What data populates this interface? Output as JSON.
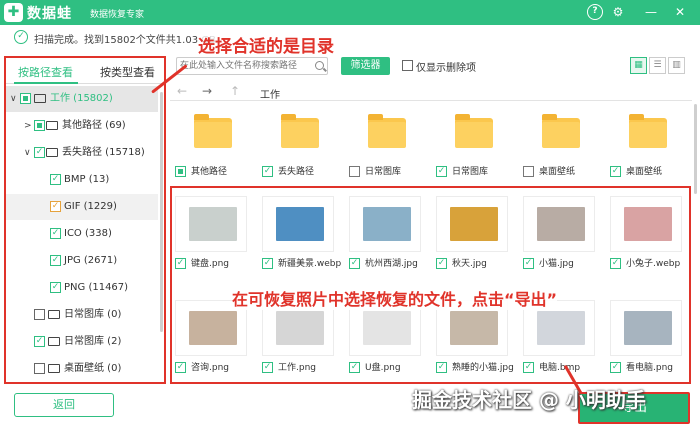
{
  "titlebar": {
    "logo": "✚",
    "app_name": "数据蛙",
    "app_subtitle": "数据恢复专家",
    "help": "?",
    "gear": "⚙",
    "min": "—",
    "close": "✕"
  },
  "status": {
    "icon": "✓",
    "text": "扫描完成。找到15802个文件共1.03 GB。"
  },
  "tabs": {
    "path": "按路径查看",
    "type": "按类型查看"
  },
  "tree": [
    {
      "label": "工作 (15802)",
      "arrow": "∨",
      "check": "partial",
      "icon": true,
      "accent": "#2fbf82"
    },
    {
      "label": "其他路径 (69)",
      "arrow": ">",
      "check": "partial",
      "icon": true
    },
    {
      "label": "丢失路径 (15718)",
      "arrow": "∨",
      "check": "checked",
      "icon": true
    },
    {
      "label": "BMP (13)",
      "check": "checked"
    },
    {
      "label": "GIF (1229)",
      "check": "checked-orange"
    },
    {
      "label": "ICO (338)",
      "check": "checked"
    },
    {
      "label": "JPG (2671)",
      "check": "checked"
    },
    {
      "label": "PNG (11467)",
      "check": "checked"
    },
    {
      "label": "日常图库 (0)",
      "check": "empty",
      "icon": true
    },
    {
      "label": "日常图库 (2)",
      "check": "checked",
      "icon": true
    },
    {
      "label": "桌面壁纸 (0)",
      "check": "empty",
      "icon": true
    }
  ],
  "back_button": "返回",
  "search": {
    "placeholder": "在此处输入文件名称搜索路径"
  },
  "filter_button": "筛选器",
  "deleted_only": "仅显示删除项",
  "view": {
    "grid": "▦",
    "list": "☰",
    "detail": "▥"
  },
  "nav": {
    "back": "←",
    "forward": "→",
    "up": "↑",
    "path": "工作"
  },
  "files": [
    {
      "name": "其他路径",
      "type": "folder",
      "checked": "partial"
    },
    {
      "name": "丢失路径",
      "type": "folder",
      "checked": true
    },
    {
      "name": "日常图库",
      "type": "folder",
      "checked": false
    },
    {
      "name": "日常图库",
      "type": "folder",
      "checked": true
    },
    {
      "name": "桌面壁纸",
      "type": "folder",
      "checked": false
    },
    {
      "name": "桌面壁纸",
      "type": "folder",
      "checked": true
    },
    {
      "name": "键盘.png",
      "type": "photo",
      "checked": true,
      "color": "#c9d0cd"
    },
    {
      "name": "新疆美景.webp",
      "type": "photo",
      "checked": true,
      "color": "#4f8fc2"
    },
    {
      "name": "杭州西湖.jpg",
      "type": "photo",
      "checked": true,
      "color": "#8ab0c8"
    },
    {
      "name": "秋天.jpg",
      "type": "photo",
      "checked": true,
      "color": "#d8a23a"
    },
    {
      "name": "小猫.jpg",
      "type": "photo",
      "checked": true,
      "color": "#b8aca4"
    },
    {
      "name": "小兔子.webp",
      "type": "photo",
      "checked": true,
      "color": "#d9a3a3"
    },
    {
      "name": "咨询.png",
      "type": "photo",
      "checked": true,
      "color": "#c7b29e"
    },
    {
      "name": "工作.png",
      "type": "photo",
      "checked": true,
      "color": "#d6d6d6"
    },
    {
      "name": "U盘.png",
      "type": "photo",
      "checked": true,
      "color": "#e4e4e4"
    },
    {
      "name": "熟睡的小猫.jpg",
      "type": "photo",
      "checked": true,
      "color": "#c6b8a8"
    },
    {
      "name": "电脑.bmp",
      "type": "photo",
      "checked": true,
      "color": "#d2d6dc"
    },
    {
      "name": "看电脑.png",
      "type": "photo",
      "checked": true,
      "color": "#a7b4bf"
    }
  ],
  "annotations": {
    "select_dir": "选择合适的是目录",
    "select_photos": "在可恢复照片中选择恢复的文件，点击“导出”"
  },
  "export_button": "导出",
  "watermark": "掘金技术社区 @ 小明助手"
}
